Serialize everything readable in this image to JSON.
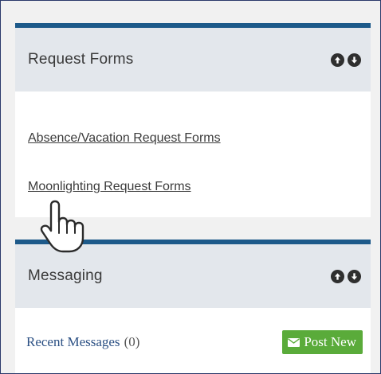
{
  "request_forms": {
    "title": "Request Forms",
    "links": [
      "Absence/Vacation Request Forms",
      "Moonlighting Request Forms"
    ]
  },
  "messaging": {
    "title": "Messaging",
    "recent_label": "Recent Messages",
    "recent_count": "(0)",
    "post_button_label": "Post New"
  },
  "icons": {
    "move_up": "arrow-up-circle-icon",
    "move_down": "arrow-down-circle-icon",
    "envelope": "envelope-icon",
    "cursor": "hand-pointer-cursor-icon"
  },
  "colors": {
    "panel_accent": "#1d5a8a",
    "header_bg": "#e3e7ec",
    "link_blue": "#2a4f83",
    "post_green": "#5aab3a"
  }
}
